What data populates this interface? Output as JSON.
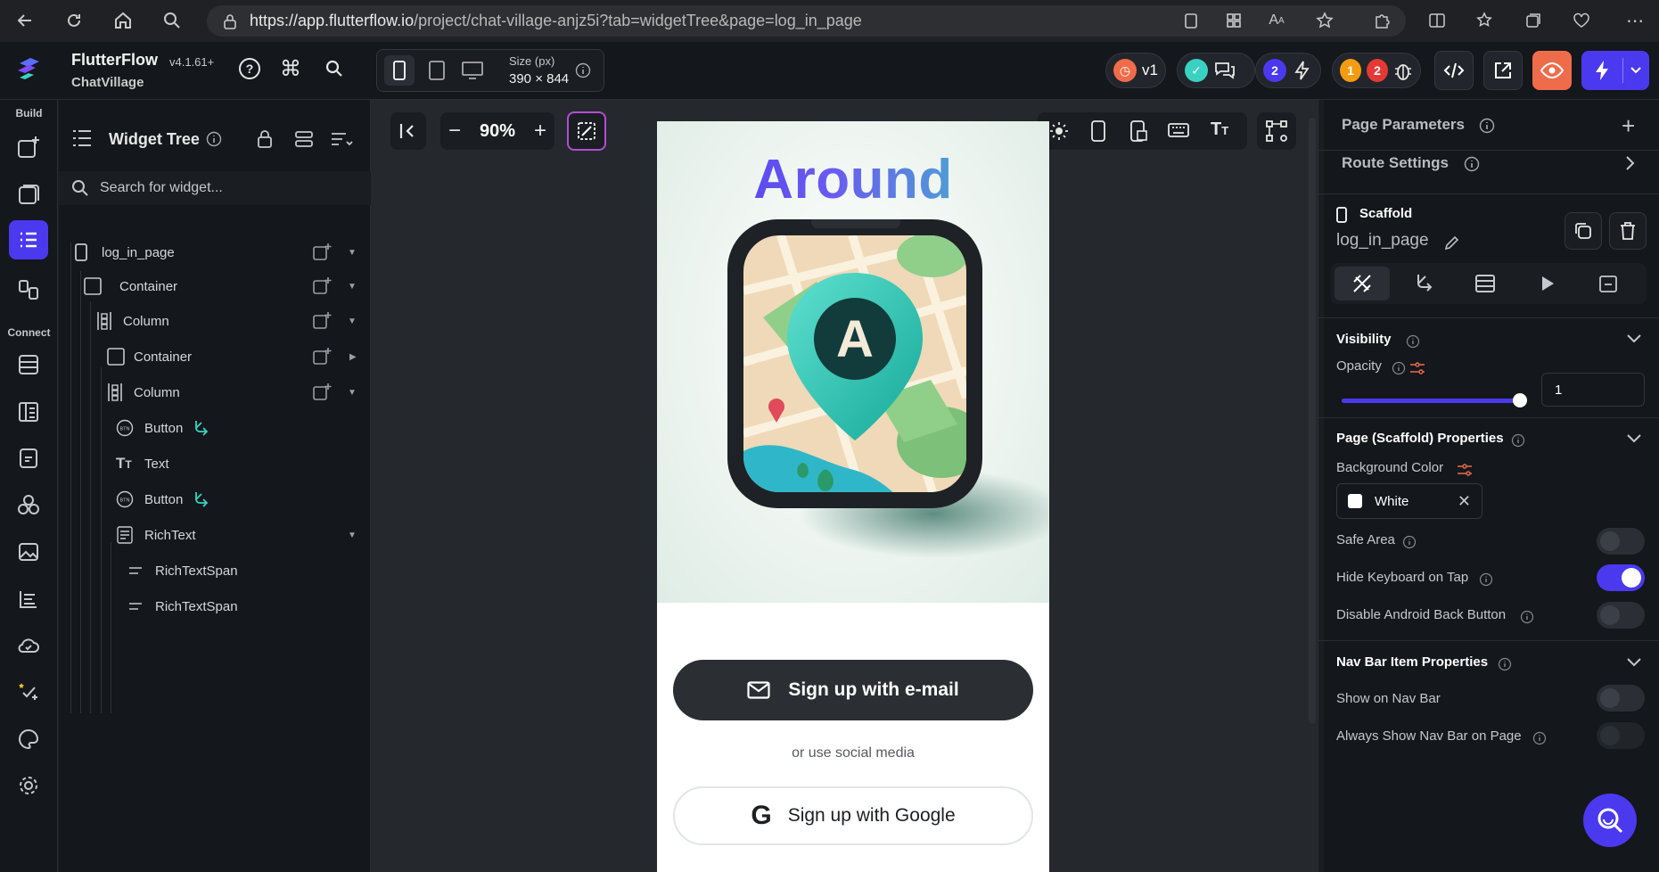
{
  "browser": {
    "url_host": "https://app.flutterflow.io",
    "url_path": "/project/chat-village-anjz5i?tab=widgetTree&page=log_in_page"
  },
  "header": {
    "app_name": "FlutterFlow",
    "version": "v4.1.61+",
    "project": "ChatVillage",
    "size_label": "Size (px)",
    "size_value": "390 × 844",
    "version_pill": "v1",
    "badge_blue": "2",
    "badge_orange": "1",
    "badge_red": "2"
  },
  "rail": {
    "build_label": "Build",
    "connect_label": "Connect"
  },
  "tree": {
    "title": "Widget Tree",
    "search_placeholder": "Search for widget...",
    "items": [
      {
        "label": "log_in_page"
      },
      {
        "label": "Container"
      },
      {
        "label": "Column"
      },
      {
        "label": "Container"
      },
      {
        "label": "Column"
      },
      {
        "label": "Button"
      },
      {
        "label": "Text"
      },
      {
        "label": "Button"
      },
      {
        "label": "RichText"
      },
      {
        "label": "RichTextSpan"
      },
      {
        "label": "RichTextSpan"
      }
    ]
  },
  "canvas": {
    "zoom": "90%"
  },
  "phone": {
    "title": "Around",
    "badge_letter": "A",
    "email_button": "Sign up with e-mail",
    "social_text": "or use social media",
    "google_button": "Sign up with Google"
  },
  "right": {
    "page_parameters": "Page Parameters",
    "route_settings": "Route Settings",
    "scaffold_label": "Scaffold",
    "page_name": "log_in_page",
    "visibility": "Visibility",
    "opacity": "Opacity",
    "opacity_value": "1",
    "opacity_level": 1,
    "scaffold_props": "Page (Scaffold) Properties",
    "bg_color_label": "Background Color",
    "bg_color_value": "White",
    "safe_area": "Safe Area",
    "hide_keyboard": "Hide Keyboard on Tap",
    "disable_back": "Disable Android Back Button",
    "nav_bar_props": "Nav Bar Item Properties",
    "show_nav": "Show on Nav Bar",
    "always_show_nav": "Always Show Nav Bar on Page"
  },
  "colors": {
    "accent": "#4b39ef",
    "title_start": "#4b39ef",
    "title_end": "#39d2c0",
    "button_dark": "#2b2e33"
  }
}
